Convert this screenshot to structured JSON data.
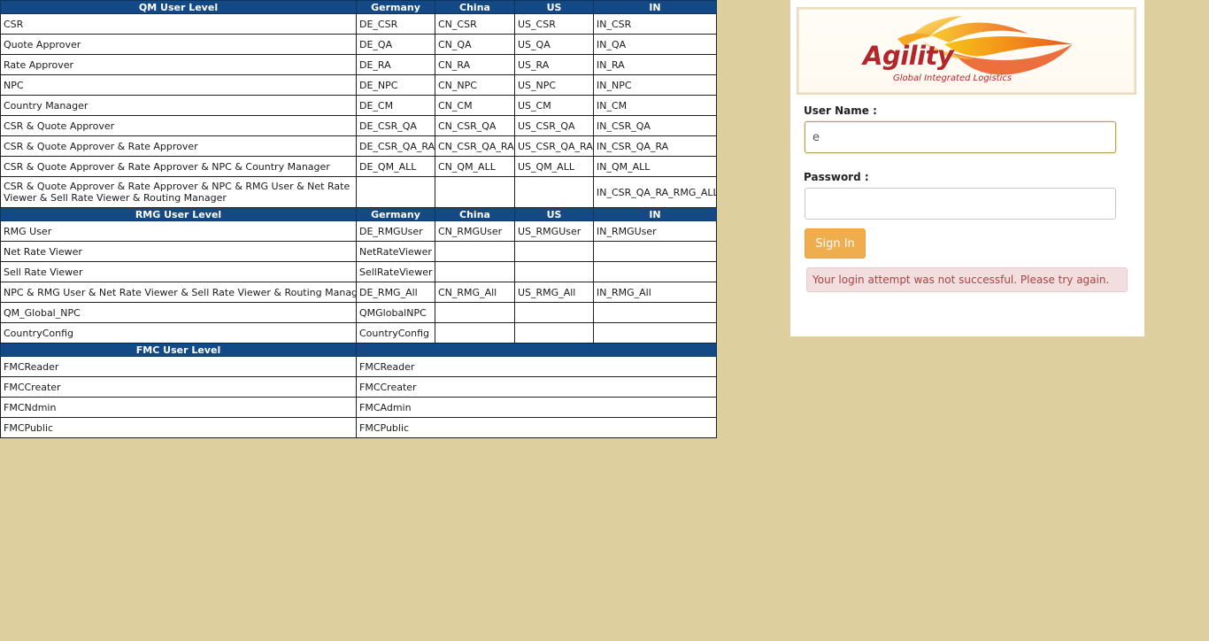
{
  "qm_section": {
    "title": "QM User Level",
    "countries": [
      "Germany",
      "China",
      "US",
      "IN"
    ],
    "rows": [
      {
        "role": "CSR",
        "cells": [
          "DE_CSR",
          "CN_CSR",
          "US_CSR",
          "IN_CSR"
        ]
      },
      {
        "role": "Quote Approver",
        "cells": [
          "DE_QA",
          "CN_QA",
          "US_QA",
          "IN_QA"
        ]
      },
      {
        "role": "Rate Approver",
        "cells": [
          "DE_RA",
          "CN_RA",
          "US_RA",
          "IN_RA"
        ]
      },
      {
        "role": "NPC",
        "cells": [
          "DE_NPC",
          "CN_NPC",
          "US_NPC",
          "IN_NPC"
        ]
      },
      {
        "role": "Country Manager",
        "cells": [
          "DE_CM",
          "CN_CM",
          "US_CM",
          "IN_CM"
        ]
      },
      {
        "role": "CSR  &  Quote Approver",
        "cells": [
          "DE_CSR_QA",
          "CN_CSR_QA",
          "US_CSR_QA",
          "IN_CSR_QA"
        ]
      },
      {
        "role": "CSR  & Quote Approver & Rate Approver",
        "cells": [
          "DE_CSR_QA_RA",
          "CN_CSR_QA_RA",
          "US_CSR_QA_RA",
          "IN_CSR_QA_RA"
        ]
      },
      {
        "role": "CSR  & Quote Approver & Rate Approver & NPC &  Country Manager",
        "cells": [
          "DE_QM_ALL",
          "CN_QM_ALL",
          "US_QM_ALL",
          "IN_QM_ALL"
        ]
      },
      {
        "role": "CSR  & Quote Approver & Rate Approver & NPC & RMG User & Net Rate Viewer & Sell Rate Viewer & Routing Manager",
        "cells": [
          "",
          "",
          "",
          "IN_CSR_QA_RA_RMG_ALL"
        ],
        "wrap": true
      }
    ]
  },
  "rmg_section": {
    "title": "RMG User Level",
    "countries": [
      "Germany",
      "China",
      "US",
      "IN"
    ],
    "rows": [
      {
        "role": "RMG User",
        "cells": [
          "DE_RMGUser",
          "CN_RMGUser",
          "US_RMGUser",
          "IN_RMGUser"
        ]
      },
      {
        "role": "Net Rate Viewer",
        "cells": [
          "NetRateViewer",
          "",
          "",
          ""
        ]
      },
      {
        "role": "Sell Rate Viewer",
        "cells": [
          "SellRateViewer",
          "",
          "",
          ""
        ]
      },
      {
        "role": "NPC & RMG User & Net Rate Viewer & Sell Rate Viewer & Routing Manager",
        "cells": [
          "DE_RMG_All",
          "CN_RMG_All",
          "US_RMG_All",
          "IN_RMG_All"
        ]
      },
      {
        "role": "QM_Global_NPC",
        "cells": [
          "QMGlobalNPC",
          "",
          "",
          ""
        ]
      },
      {
        "role": "CountryConfig",
        "cells": [
          "CountryConfig",
          "",
          "",
          ""
        ]
      }
    ]
  },
  "fmc_section": {
    "title": "FMC User Level",
    "rows": [
      {
        "role": "FMCReader",
        "value": "FMCReader"
      },
      {
        "role": "FMCCreater",
        "value": "FMCCreater"
      },
      {
        "role": "FMCNdmin",
        "value": "FMCAdmin"
      },
      {
        "role": "FMCPublic",
        "value": "FMCPublic"
      }
    ]
  },
  "login": {
    "logo": {
      "wordmark": "Agility",
      "tagline": "Global Integrated Logistics",
      "brand_color": "#b3262b"
    },
    "username_label": "User Name :",
    "username_value": "e",
    "password_label": "Password :",
    "password_value": "",
    "signin_label": "Sign In",
    "error_message": "Your login attempt was not successful. Please try again."
  },
  "colors": {
    "page_background": "#decf9f",
    "table_header": "#134a85",
    "signin_button": "#f0ad4e",
    "error_background": "#f2dede",
    "error_text": "#a94442"
  }
}
